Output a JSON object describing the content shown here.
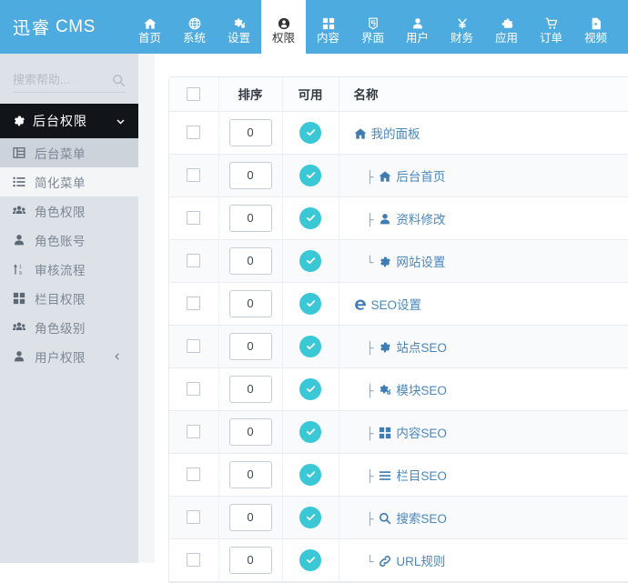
{
  "header": {
    "logo_cn": "迅睿",
    "logo_en": "CMS",
    "brand_color": "#4dabe0",
    "nav": [
      {
        "label": "首页",
        "icon": "home-icon",
        "active": false
      },
      {
        "label": "系统",
        "icon": "globe-icon",
        "active": false
      },
      {
        "label": "设置",
        "icon": "gears-icon",
        "active": false
      },
      {
        "label": "权限",
        "icon": "user-circle-icon",
        "active": true
      },
      {
        "label": "内容",
        "icon": "grid-icon",
        "active": false
      },
      {
        "label": "界面",
        "icon": "html5-icon",
        "active": false
      },
      {
        "label": "用户",
        "icon": "user-icon",
        "active": false
      },
      {
        "label": "财务",
        "icon": "yen-icon",
        "active": false
      },
      {
        "label": "应用",
        "icon": "puzzle-icon",
        "active": false
      },
      {
        "label": "订单",
        "icon": "cart-icon",
        "active": false
      },
      {
        "label": "视频",
        "icon": "video-file-icon",
        "active": false
      }
    ]
  },
  "sidebar": {
    "search": {
      "placeholder": "搜索帮助...",
      "value": "",
      "icon": "search-icon"
    },
    "group": {
      "label": "后台权限",
      "icon": "gear-icon",
      "caret": "chevron-down-icon"
    },
    "items": [
      {
        "label": "后台菜单",
        "icon": "table-list-icon",
        "state": "sel-dark"
      },
      {
        "label": "简化菜单",
        "icon": "list-ul-icon",
        "state": "sel-light"
      },
      {
        "label": "角色权限",
        "icon": "users-icon",
        "state": ""
      },
      {
        "label": "角色账号",
        "icon": "user-icon",
        "state": ""
      },
      {
        "label": "审核流程",
        "icon": "sort-icon",
        "state": ""
      },
      {
        "label": "栏目权限",
        "icon": "grid-icon",
        "state": ""
      },
      {
        "label": "角色级别",
        "icon": "users-icon",
        "state": ""
      },
      {
        "label": "用户权限",
        "icon": "user-icon",
        "state": "",
        "collapse_icon": "chevron-left-icon"
      }
    ]
  },
  "table": {
    "columns": [
      {
        "key": "checkbox",
        "label": ""
      },
      {
        "key": "sort",
        "label": "排序"
      },
      {
        "key": "available",
        "label": "可用"
      },
      {
        "key": "name",
        "label": "名称"
      }
    ],
    "available_color": "#3ac7d6",
    "rows": [
      {
        "sort": "0",
        "available": true,
        "level": 0,
        "tree": "",
        "icon": "home-icon",
        "name": "我的面板"
      },
      {
        "sort": "0",
        "available": true,
        "level": 1,
        "tree": "├",
        "icon": "home-icon",
        "name": "后台首页"
      },
      {
        "sort": "0",
        "available": true,
        "level": 1,
        "tree": "├",
        "icon": "user-icon",
        "name": "资料修改"
      },
      {
        "sort": "0",
        "available": true,
        "level": 1,
        "tree": "└",
        "icon": "gear-icon",
        "name": "网站设置"
      },
      {
        "sort": "0",
        "available": true,
        "level": 0,
        "tree": "",
        "icon": "edge-icon",
        "name": "SEO设置"
      },
      {
        "sort": "0",
        "available": true,
        "level": 1,
        "tree": "├",
        "icon": "gear-icon",
        "name": "站点SEO"
      },
      {
        "sort": "0",
        "available": true,
        "level": 1,
        "tree": "├",
        "icon": "gears-icon",
        "name": "模块SEO"
      },
      {
        "sort": "0",
        "available": true,
        "level": 1,
        "tree": "├",
        "icon": "grid-icon",
        "name": "内容SEO"
      },
      {
        "sort": "0",
        "available": true,
        "level": 1,
        "tree": "├",
        "icon": "bars-icon",
        "name": "栏目SEO"
      },
      {
        "sort": "0",
        "available": true,
        "level": 1,
        "tree": "├",
        "icon": "search-icon",
        "name": "搜索SEO"
      },
      {
        "sort": "0",
        "available": true,
        "level": 1,
        "tree": "└",
        "icon": "link-icon",
        "name": "URL规则"
      }
    ]
  }
}
